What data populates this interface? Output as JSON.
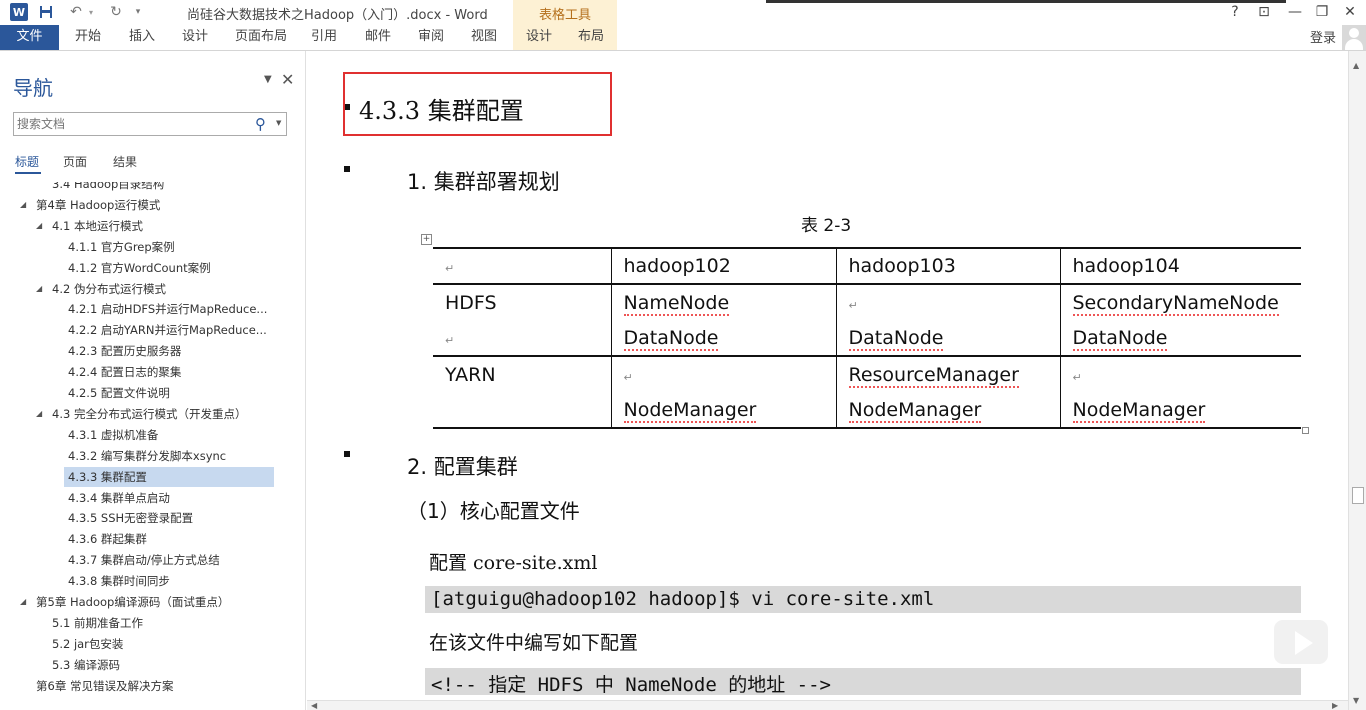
{
  "window": {
    "title": "尚硅谷大数据技术之Hadoop（入门）.docx - Word",
    "contextual_tab_group": "表格工具",
    "login": "登录",
    "help": "?",
    "controls": {
      "ribbon": "⊡",
      "minimize": "—",
      "restore": "❐",
      "close": "✕"
    }
  },
  "ribbon": {
    "tabs": [
      "文件",
      "开始",
      "插入",
      "设计",
      "页面布局",
      "引用",
      "邮件",
      "审阅",
      "视图",
      "设计",
      "布局"
    ]
  },
  "nav": {
    "title": "导航",
    "search_placeholder": "搜索文档",
    "tabs": [
      "标题",
      "页面",
      "结果"
    ],
    "items": [
      {
        "label": "3.4 Hadoop目录结构",
        "level": 2,
        "expand": ""
      },
      {
        "label": "第4章 Hadoop运行模式",
        "level": 1,
        "expand": "◢"
      },
      {
        "label": "4.1 本地运行模式",
        "level": 2,
        "expand": "◢"
      },
      {
        "label": "4.1.1 官方Grep案例",
        "level": 3,
        "expand": ""
      },
      {
        "label": "4.1.2 官方WordCount案例",
        "level": 3,
        "expand": ""
      },
      {
        "label": "4.2 伪分布式运行模式",
        "level": 2,
        "expand": "◢"
      },
      {
        "label": "4.2.1 启动HDFS并运行MapReduce...",
        "level": 3,
        "expand": ""
      },
      {
        "label": "4.2.2 启动YARN并运行MapReduce...",
        "level": 3,
        "expand": ""
      },
      {
        "label": "4.2.3 配置历史服务器",
        "level": 3,
        "expand": ""
      },
      {
        "label": "4.2.4 配置日志的聚集",
        "level": 3,
        "expand": ""
      },
      {
        "label": "4.2.5 配置文件说明",
        "level": 3,
        "expand": ""
      },
      {
        "label": "4.3 完全分布式运行模式（开发重点）",
        "level": 2,
        "expand": "◢"
      },
      {
        "label": "4.3.1 虚拟机准备",
        "level": 3,
        "expand": ""
      },
      {
        "label": "4.3.2 编写集群分发脚本xsync",
        "level": 3,
        "expand": ""
      },
      {
        "label": "4.3.3 集群配置",
        "level": 3,
        "expand": "",
        "selected": true
      },
      {
        "label": "4.3.4 集群单点启动",
        "level": 3,
        "expand": ""
      },
      {
        "label": "4.3.5 SSH无密登录配置",
        "level": 3,
        "expand": ""
      },
      {
        "label": "4.3.6 群起集群",
        "level": 3,
        "expand": ""
      },
      {
        "label": "4.3.7 集群启动/停止方式总结",
        "level": 3,
        "expand": ""
      },
      {
        "label": "4.3.8 集群时间同步",
        "level": 3,
        "expand": ""
      },
      {
        "label": "第5章 Hadoop编译源码（面试重点）",
        "level": 1,
        "expand": "◢"
      },
      {
        "label": "5.1 前期准备工作",
        "level": 2,
        "expand": ""
      },
      {
        "label": "5.2 jar包安装",
        "level": 2,
        "expand": ""
      },
      {
        "label": "5.3 编译源码",
        "level": 2,
        "expand": ""
      },
      {
        "label": "第6章 常见错误及解决方案",
        "level": 1,
        "expand": ""
      }
    ]
  },
  "document": {
    "heading": "4.3.3  集群配置",
    "section1": "1.   集群部署规划",
    "table_caption": "表 2-3",
    "table": {
      "header": [
        "",
        "hadoop102",
        "hadoop103",
        "hadoop104"
      ],
      "rows": [
        [
          "HDFS",
          "NameNode",
          "",
          "SecondaryNameNode"
        ],
        [
          "",
          "DataNode",
          "DataNode",
          "DataNode"
        ],
        [
          "YARN",
          "",
          "ResourceManager",
          ""
        ],
        [
          "",
          "NodeManager",
          "NodeManager",
          "NodeManager"
        ]
      ]
    },
    "section2": "2.   配置集群",
    "subsection": "（1）核心配置文件",
    "line1": "配置 core-site.xml",
    "code1": "[atguigu@hadoop102 hadoop]$ vi core-site.xml",
    "line2": "在该文件中编写如下配置",
    "code2": "<!-- 指定 HDFS 中 NameNode 的地址 -->"
  },
  "colors": {
    "accent": "#2b579a",
    "highlight_box": "#e03030",
    "table_tools": "#b5701d"
  }
}
